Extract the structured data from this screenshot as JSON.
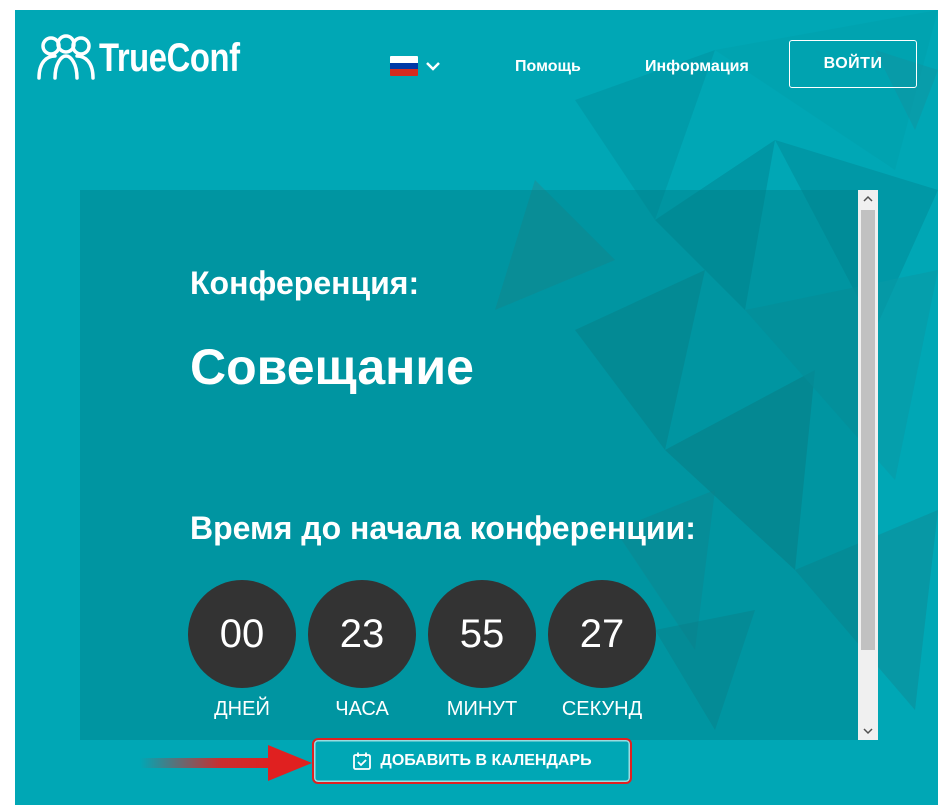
{
  "header": {
    "logo_text": "TrueConf",
    "language": {
      "flag": "russian-flag",
      "flag_colors": [
        "#ffffff",
        "#0039a6",
        "#d52b1e"
      ]
    },
    "nav": [
      {
        "label": "Помощь"
      },
      {
        "label": "Информация"
      }
    ],
    "login_label": "ВОЙТИ"
  },
  "conference": {
    "label": "Конференция:",
    "name": "Совещание"
  },
  "countdown": {
    "title": "Время до начала конференции:",
    "units": [
      {
        "value": "00",
        "label": "ДНЕЙ"
      },
      {
        "value": "23",
        "label": "ЧАСА"
      },
      {
        "value": "55",
        "label": "МИНУТ"
      },
      {
        "value": "27",
        "label": "СЕКУНД"
      }
    ]
  },
  "calendar_button": {
    "label": "ДОБАВИТЬ В КАЛЕНДАРЬ",
    "icon": "calendar-check-icon"
  },
  "colors": {
    "background": "#00a7b5",
    "timer_circle": "#333333",
    "annotation_red": "#e02020"
  }
}
